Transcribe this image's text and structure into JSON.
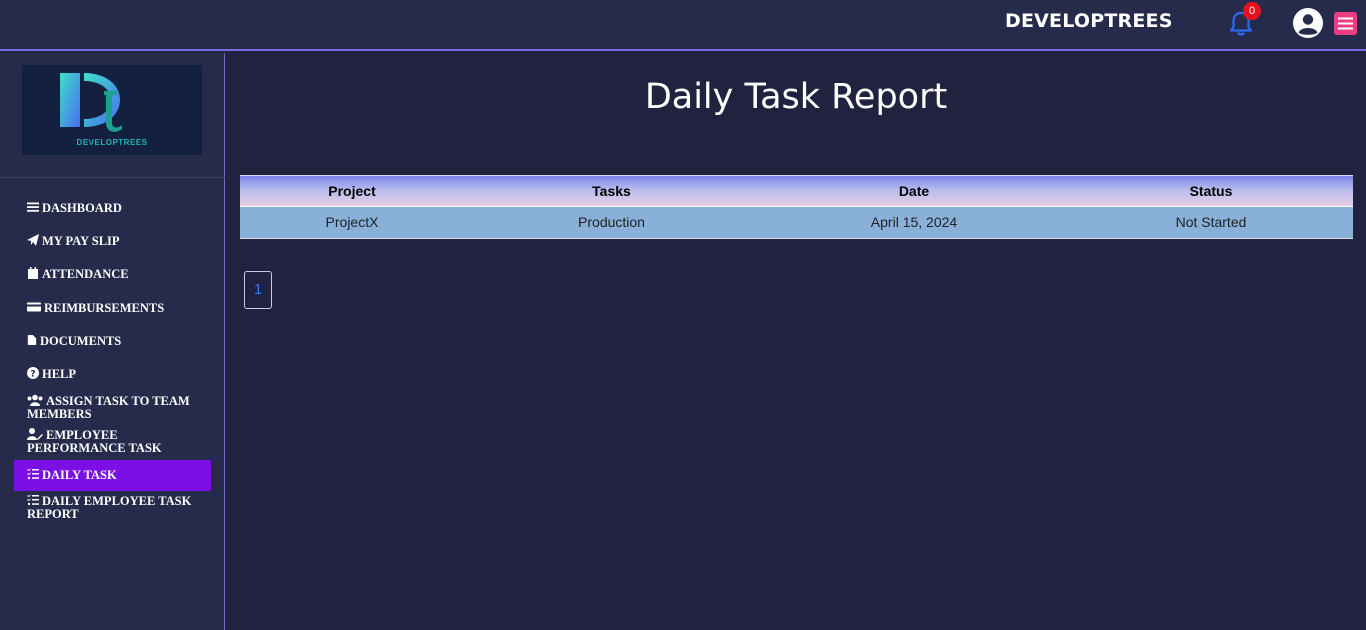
{
  "header": {
    "brand": "DEVELOPTREES",
    "notifications_count": "0"
  },
  "sidebar": {
    "logo_text": "DEVELOPTREES",
    "items": [
      {
        "label": "DASHBOARD",
        "icon": "bars-icon"
      },
      {
        "label": "MY PAY SLIP",
        "icon": "paper-plane-icon"
      },
      {
        "label": "ATTENDANCE",
        "icon": "calendar-icon"
      },
      {
        "label": "REIMBURSEMENTS",
        "icon": "credit-card-icon"
      },
      {
        "label": "DOCUMENTS",
        "icon": "file-icon"
      },
      {
        "label": "HELP",
        "icon": "question-circle-icon"
      },
      {
        "label": "ASSIGN TASK TO TEAM MEMBERS",
        "icon": "users-icon"
      },
      {
        "label": "EMPLOYEE PERFORMANCE TASK",
        "icon": "user-edit-icon"
      },
      {
        "label": "DAILY TASK",
        "icon": "list-check-icon"
      },
      {
        "label": "DAILY EMPLOYEE TASK REPORT",
        "icon": "list-check-icon"
      }
    ],
    "active_index": 8
  },
  "main": {
    "title": "Daily Task Report",
    "table": {
      "headers": [
        "Project",
        "Tasks",
        "Date",
        "Status"
      ],
      "rows": [
        [
          "ProjectX",
          "Production",
          "April 15, 2024",
          "Not Started"
        ]
      ]
    },
    "pagination": {
      "current_page": "1"
    }
  },
  "colors": {
    "topbar": "#262a4b",
    "background": "#20223f",
    "active_nav": "#7b0fe5",
    "table_row": "#88b0d9",
    "badge": "#e8101c",
    "menu_button": "#ee3d82"
  }
}
